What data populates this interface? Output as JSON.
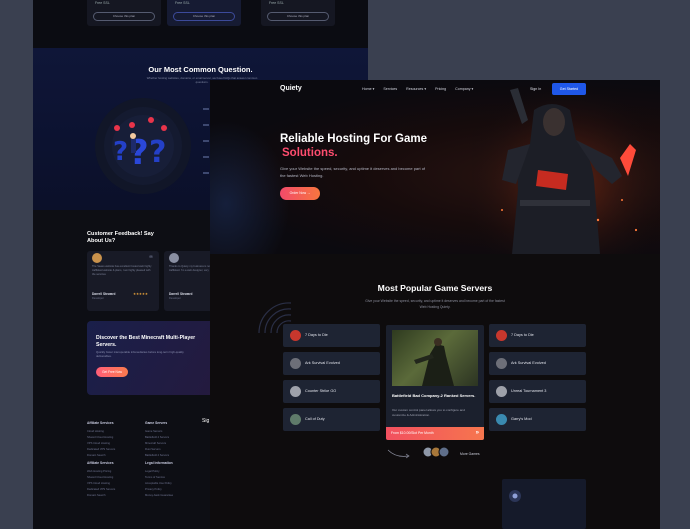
{
  "back_page": {
    "plans": [
      {
        "button": "Choose this plan",
        "feature": "Free SSL"
      },
      {
        "button": "Choose this plan",
        "feature": "Free SSL"
      },
      {
        "button": "Choose this plan",
        "feature": "Free SSL"
      }
    ],
    "faq": {
      "title": "Our Most Common Question.",
      "subtitle": "Whether hosting websites, domains, or email server, we have FAQs that answer common questions."
    },
    "feedback": {
      "title": "Customer Feedback! Say About Us?",
      "cards": [
        {
          "text": "The Saaso website has excellent hosted web highly trafficked website & plans, I am highly pleased with the services",
          "name": "Darrell Steward",
          "role": "Developer",
          "rating": "★★★★★"
        },
        {
          "text": "Thanks to Quiety my business is now highly trafficked. I'm a web designer, very",
          "name": "Darrell Steward",
          "role": "Developer",
          "rating": ""
        }
      ]
    },
    "minecraft": {
      "title": "Discover the Best Minecraft Multi-Player Servers.",
      "text": "Quickly foster interoperable infomediaries before long-term high-quality deliverables.",
      "button": "Get Free Now"
    },
    "footer": {
      "col1_title": "Affiliate Services",
      "col1_items": [
        "Cloud Hosting",
        "Shared Cloud Hosting",
        "VPS Cloud Hosting",
        "Dedicated VPS Servers",
        "Domain Search"
      ],
      "col2_title": "Game Servers",
      "col2_items": [
        "Game Servers",
        "Battlefield 4 Servers",
        "Minecraft Servers",
        "Rust Servers",
        "Battlefield 4 Servers"
      ],
      "col3_title": "Affiliate Services",
      "col3_items": [
        "Web Hosting Pricing",
        "Shared Cloud Hosting",
        "VPS Cloud Hosting",
        "Dedicated VPS Servers",
        "Domain Search"
      ],
      "col4_title": "Legal Information",
      "col4_items": [
        "Legal Policy",
        "Terms of Service",
        "Acceptable Use Policy",
        "Privacy Policy",
        "Money-back Guarantee"
      ],
      "side_label": "Sig"
    }
  },
  "front_page": {
    "nav": {
      "logo": "Quiety",
      "links": [
        "Home ▾",
        "Services",
        "Resources ▾",
        "Pricing",
        "Company ▾"
      ],
      "signin": "Sign In",
      "cta": "Get Started"
    },
    "hero": {
      "title_line1": "Reliable Hosting For Game",
      "title_line2": "Solutions.",
      "subtitle": "Give your Website the speed, security, and uptime it deserves and become part of the fastest Web Hosting.",
      "button": "Order Now →"
    },
    "popular": {
      "title": "Most Popular Game Servers",
      "subtitle": "Give your Website the speed, security, and uptime it deserves and become part of the fastest Web Hosting Quiety."
    },
    "left_games": [
      "7 Days to Die",
      "Ark Survival Evolved",
      "Counter Strike GO",
      "Call of Duty"
    ],
    "right_games": [
      "7 Days to Die",
      "Ark Survival Evolved",
      "Unreal Tournament 3",
      "Garry's Mod"
    ],
    "featured": {
      "title": "Battlefield Bad Company-2 Ranked Servers.",
      "description": "Our custom control panel allows you to configure and customize & Administration.",
      "price": "From $10.00/Slot Per Month",
      "arrow": "»"
    },
    "more": "More Games"
  },
  "colors": {
    "accent_pink": "#ff4d6f",
    "accent_orange": "#f7763f",
    "cta_blue": "#1f57e8",
    "tile_bg": "#1e2433"
  }
}
